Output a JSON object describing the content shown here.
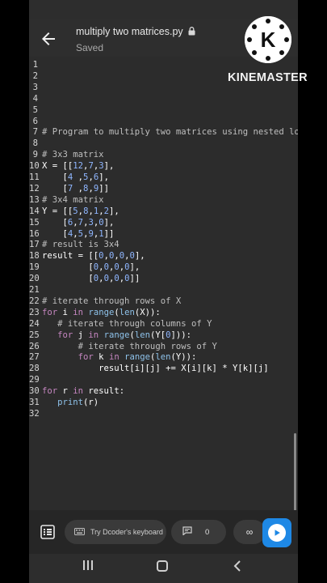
{
  "app": {
    "file_name": "multiply two matrices.py",
    "save_status": "Saved"
  },
  "watermark": {
    "text": "KINEMASTER",
    "logo_letter": "K"
  },
  "editor": {
    "lines": [
      {
        "n": "1",
        "tokens": []
      },
      {
        "n": "2",
        "tokens": []
      },
      {
        "n": "3",
        "tokens": []
      },
      {
        "n": "4",
        "tokens": []
      },
      {
        "n": "5",
        "tokens": []
      },
      {
        "n": "6",
        "tokens": []
      },
      {
        "n": "7",
        "tokens": [
          {
            "t": "# Program to multiply two matrices using nested loops",
            "c": "cm"
          }
        ]
      },
      {
        "n": "8",
        "tokens": []
      },
      {
        "n": "9",
        "tokens": [
          {
            "t": "# 3x3 matrix",
            "c": "cm"
          }
        ]
      },
      {
        "n": "10",
        "tokens": [
          {
            "t": "X = [[",
            "c": "var"
          },
          {
            "t": "12",
            "c": "num"
          },
          {
            "t": ",",
            "c": "var"
          },
          {
            "t": "7",
            "c": "num"
          },
          {
            "t": ",",
            "c": "var"
          },
          {
            "t": "3",
            "c": "num"
          },
          {
            "t": "],",
            "c": "var"
          }
        ]
      },
      {
        "n": "11",
        "tokens": [
          {
            "t": "    [",
            "c": "var"
          },
          {
            "t": "4",
            "c": "num"
          },
          {
            "t": " ,",
            "c": "var"
          },
          {
            "t": "5",
            "c": "num"
          },
          {
            "t": ",",
            "c": "var"
          },
          {
            "t": "6",
            "c": "num"
          },
          {
            "t": "],",
            "c": "var"
          }
        ]
      },
      {
        "n": "12",
        "tokens": [
          {
            "t": "    [",
            "c": "var"
          },
          {
            "t": "7",
            "c": "num"
          },
          {
            "t": " ,",
            "c": "var"
          },
          {
            "t": "8",
            "c": "num"
          },
          {
            "t": ",",
            "c": "var"
          },
          {
            "t": "9",
            "c": "num"
          },
          {
            "t": "]]",
            "c": "var"
          }
        ]
      },
      {
        "n": "13",
        "tokens": [
          {
            "t": "# 3x4 matrix",
            "c": "cm"
          }
        ]
      },
      {
        "n": "14",
        "tokens": [
          {
            "t": "Y = [[",
            "c": "var"
          },
          {
            "t": "5",
            "c": "num"
          },
          {
            "t": ",",
            "c": "var"
          },
          {
            "t": "8",
            "c": "num"
          },
          {
            "t": ",",
            "c": "var"
          },
          {
            "t": "1",
            "c": "num"
          },
          {
            "t": ",",
            "c": "var"
          },
          {
            "t": "2",
            "c": "num"
          },
          {
            "t": "],",
            "c": "var"
          }
        ]
      },
      {
        "n": "15",
        "tokens": [
          {
            "t": "    [",
            "c": "var"
          },
          {
            "t": "6",
            "c": "num"
          },
          {
            "t": ",",
            "c": "var"
          },
          {
            "t": "7",
            "c": "num"
          },
          {
            "t": ",",
            "c": "var"
          },
          {
            "t": "3",
            "c": "num"
          },
          {
            "t": ",",
            "c": "var"
          },
          {
            "t": "0",
            "c": "num"
          },
          {
            "t": "],",
            "c": "var"
          }
        ]
      },
      {
        "n": "16",
        "tokens": [
          {
            "t": "    [",
            "c": "var"
          },
          {
            "t": "4",
            "c": "num"
          },
          {
            "t": ",",
            "c": "var"
          },
          {
            "t": "5",
            "c": "num"
          },
          {
            "t": ",",
            "c": "var"
          },
          {
            "t": "9",
            "c": "num"
          },
          {
            "t": ",",
            "c": "var"
          },
          {
            "t": "1",
            "c": "num"
          },
          {
            "t": "]]",
            "c": "var"
          }
        ]
      },
      {
        "n": "17",
        "tokens": [
          {
            "t": "# result is 3x4",
            "c": "cm"
          }
        ]
      },
      {
        "n": "18",
        "tokens": [
          {
            "t": "result = [[",
            "c": "var"
          },
          {
            "t": "0",
            "c": "num"
          },
          {
            "t": ",",
            "c": "var"
          },
          {
            "t": "0",
            "c": "num"
          },
          {
            "t": ",",
            "c": "var"
          },
          {
            "t": "0",
            "c": "num"
          },
          {
            "t": ",",
            "c": "var"
          },
          {
            "t": "0",
            "c": "num"
          },
          {
            "t": "],",
            "c": "var"
          }
        ]
      },
      {
        "n": "19",
        "tokens": [
          {
            "t": "         [",
            "c": "var"
          },
          {
            "t": "0",
            "c": "num"
          },
          {
            "t": ",",
            "c": "var"
          },
          {
            "t": "0",
            "c": "num"
          },
          {
            "t": ",",
            "c": "var"
          },
          {
            "t": "0",
            "c": "num"
          },
          {
            "t": ",",
            "c": "var"
          },
          {
            "t": "0",
            "c": "num"
          },
          {
            "t": "],",
            "c": "var"
          }
        ]
      },
      {
        "n": "20",
        "tokens": [
          {
            "t": "         [",
            "c": "var"
          },
          {
            "t": "0",
            "c": "num"
          },
          {
            "t": ",",
            "c": "var"
          },
          {
            "t": "0",
            "c": "num"
          },
          {
            "t": ",",
            "c": "var"
          },
          {
            "t": "0",
            "c": "num"
          },
          {
            "t": ",",
            "c": "var"
          },
          {
            "t": "0",
            "c": "num"
          },
          {
            "t": "]]",
            "c": "var"
          }
        ]
      },
      {
        "n": "21",
        "tokens": []
      },
      {
        "n": "22",
        "tokens": [
          {
            "t": "# iterate through rows of X",
            "c": "cm"
          }
        ]
      },
      {
        "n": "23",
        "tokens": [
          {
            "t": "for",
            "c": "kw"
          },
          {
            "t": " i ",
            "c": "var"
          },
          {
            "t": "in",
            "c": "kw"
          },
          {
            "t": " ",
            "c": "var"
          },
          {
            "t": "range",
            "c": "fn"
          },
          {
            "t": "(",
            "c": "var"
          },
          {
            "t": "len",
            "c": "fn"
          },
          {
            "t": "(X)):",
            "c": "var"
          }
        ]
      },
      {
        "n": "24",
        "tokens": [
          {
            "t": "   # iterate through columns of Y",
            "c": "cm"
          }
        ]
      },
      {
        "n": "25",
        "tokens": [
          {
            "t": "   ",
            "c": "var"
          },
          {
            "t": "for",
            "c": "kw"
          },
          {
            "t": " j ",
            "c": "var"
          },
          {
            "t": "in",
            "c": "kw"
          },
          {
            "t": " ",
            "c": "var"
          },
          {
            "t": "range",
            "c": "fn"
          },
          {
            "t": "(",
            "c": "var"
          },
          {
            "t": "len",
            "c": "fn"
          },
          {
            "t": "(Y[",
            "c": "var"
          },
          {
            "t": "0",
            "c": "num"
          },
          {
            "t": "])):",
            "c": "var"
          }
        ]
      },
      {
        "n": "26",
        "tokens": [
          {
            "t": "       # iterate through rows of Y",
            "c": "cm"
          }
        ]
      },
      {
        "n": "27",
        "tokens": [
          {
            "t": "       ",
            "c": "var"
          },
          {
            "t": "for",
            "c": "kw"
          },
          {
            "t": " k ",
            "c": "var"
          },
          {
            "t": "in",
            "c": "kw"
          },
          {
            "t": " ",
            "c": "var"
          },
          {
            "t": "range",
            "c": "fn"
          },
          {
            "t": "(",
            "c": "var"
          },
          {
            "t": "len",
            "c": "fn"
          },
          {
            "t": "(Y)):",
            "c": "var"
          }
        ]
      },
      {
        "n": "28",
        "tokens": [
          {
            "t": "           result[i][j] += X[i][k] * Y[k][j]",
            "c": "var"
          }
        ]
      },
      {
        "n": "29",
        "tokens": []
      },
      {
        "n": "30",
        "tokens": [
          {
            "t": "for",
            "c": "kw"
          },
          {
            "t": " r ",
            "c": "var"
          },
          {
            "t": "in",
            "c": "kw"
          },
          {
            "t": " result:",
            "c": "var"
          }
        ]
      },
      {
        "n": "31",
        "tokens": [
          {
            "t": "   ",
            "c": "var"
          },
          {
            "t": "print",
            "c": "fn"
          },
          {
            "t": "(r)",
            "c": "var"
          }
        ]
      },
      {
        "n": "32",
        "tokens": []
      }
    ]
  },
  "toolbar": {
    "keyboard_label": "Try Dcoder's keyboard",
    "comment_count": "0",
    "share_symbol": "∞"
  },
  "colors": {
    "run_button": "#1e88e5",
    "editor_bg": "#2c2c2c"
  }
}
